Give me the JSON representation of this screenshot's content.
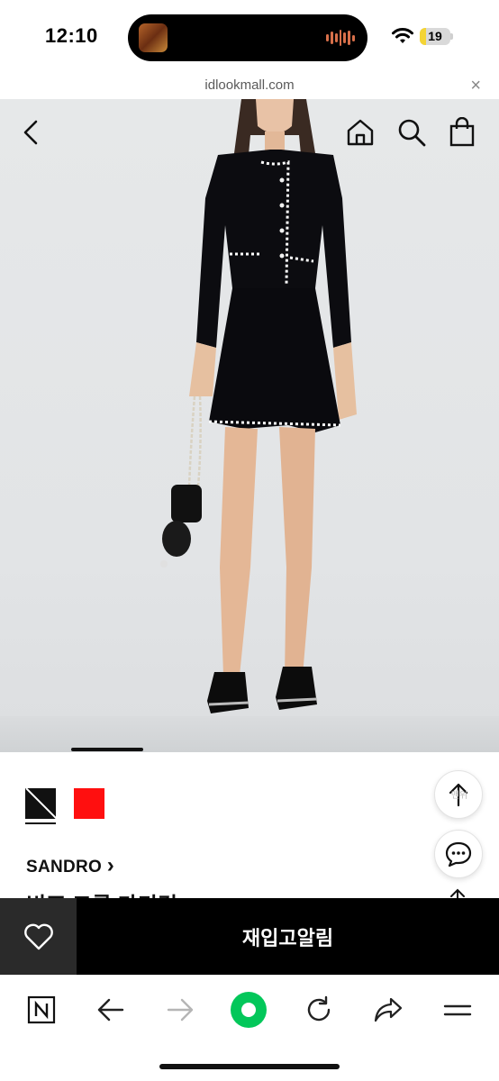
{
  "status_bar": {
    "time": "12:10",
    "battery": "19",
    "battery_level": 0.19
  },
  "browser": {
    "url": "idlookmall.com",
    "close_icon": "×"
  },
  "hero": {
    "icons": [
      "back-icon",
      "home-icon",
      "search-icon",
      "bag-icon"
    ],
    "image": "model wearing black cardigan and mini skirt with white scalloped trim, chain bag, black loafers"
  },
  "product": {
    "swatches": [
      {
        "name": "black",
        "color": "#111111",
        "selected": true
      },
      {
        "name": "red",
        "color": "#ff0f0f",
        "selected": false
      }
    ],
    "brand": "SANDRO",
    "brand_arrow": "›",
    "title": "비조 크롭 가디건",
    "scroll_top_label": "맨위"
  },
  "action_bar": {
    "wish_icon": "heart-icon",
    "restock_label": "재입고알림"
  },
  "toolbar": {
    "items": [
      "naver-n-icon",
      "back-arrow-icon",
      "forward-arrow-icon",
      "green-dot-home-icon",
      "reload-icon",
      "share-icon",
      "menu-icon"
    ]
  },
  "colors": {
    "accent_green": "#03c75a",
    "action_bar": "#000000",
    "wish_bg": "#2a2a2a"
  }
}
